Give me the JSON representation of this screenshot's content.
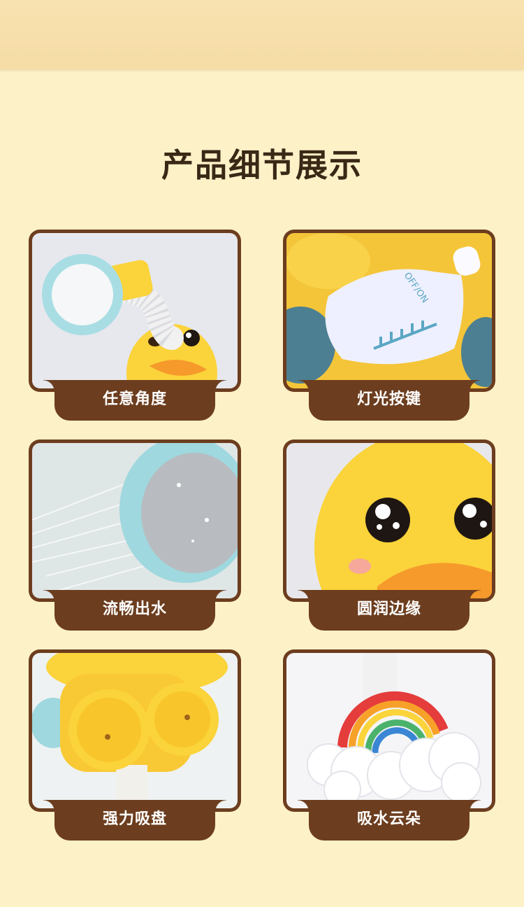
{
  "page": {
    "title": "产品细节展示"
  },
  "cards": [
    {
      "label": "任意角度",
      "image": "duck-with-flexible-shower-hose"
    },
    {
      "label": "灯光按键",
      "image": "baby-bottle-light-button"
    },
    {
      "label": "流畅出水",
      "image": "shower-head-water-spray"
    },
    {
      "label": "圆润边缘",
      "image": "duck-face-closeup"
    },
    {
      "label": "强力吸盘",
      "image": "yellow-suction-cups"
    },
    {
      "label": "吸水云朵",
      "image": "rainbow-cloud"
    }
  ],
  "bottle_marking": "OFF/ON",
  "colors": {
    "background": "#fdf1c8",
    "card_frame": "#6c3d1e",
    "title": "#3a2816",
    "duck_yellow": "#fbd33a",
    "beak_orange": "#f69a2b",
    "aqua": "#9fd8de"
  }
}
